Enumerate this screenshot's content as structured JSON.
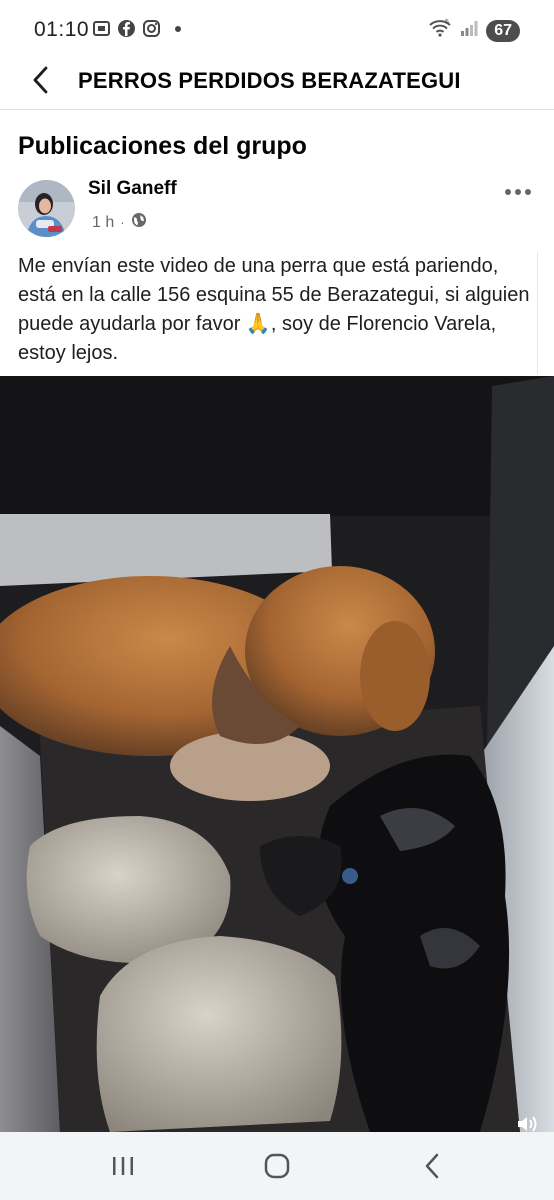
{
  "status_bar": {
    "time": "01:10",
    "battery": "67",
    "icons_left": [
      "screenshot-icon",
      "facebook-icon",
      "instagram-icon",
      "notification-dot"
    ],
    "icons_right": [
      "wifi-icon",
      "signal-icon",
      "battery-icon"
    ]
  },
  "app_bar": {
    "title": "PERROS PERDIDOS BERAZATEGUI",
    "back_icon": "back-arrow-icon"
  },
  "section": {
    "title": "Publicaciones del grupo"
  },
  "post": {
    "author": "Sil Ganeff",
    "time": "1 h",
    "separator": "·",
    "privacy_icon": "globe-icon",
    "text": "Me envían este video de una perra que está pariendo, está en la calle 156 esquina 55 de Berazategui, si alguien puede ayudarla por favor 🙏, soy de Florencio Varela, estoy lejos.",
    "more_icon": "more-options-icon"
  },
  "video": {
    "sound_icon": "volume-icon"
  },
  "nav_bar": {
    "items": [
      "recent-apps-icon",
      "home-icon",
      "back-icon"
    ]
  },
  "colors": {
    "text_primary": "#050505",
    "text_secondary": "#65676b",
    "divider": "#dadde1",
    "nav_bg": "#f3f4f6"
  }
}
